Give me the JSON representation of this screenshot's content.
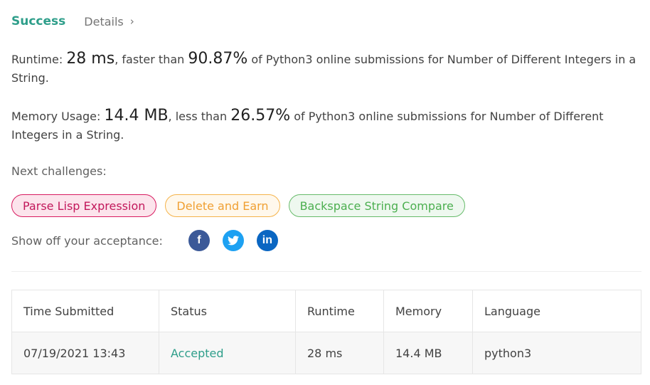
{
  "header": {
    "status": "Success",
    "details_label": "Details",
    "details_chevron": "›"
  },
  "runtime": {
    "label": "Runtime: ",
    "value": "28 ms",
    "comparator": ", faster than ",
    "percent": "90.87%",
    "suffix": " of Python3 online submissions for Number of Different Integers in a String."
  },
  "memory": {
    "label": "Memory Usage: ",
    "value": "14.4 MB",
    "comparator": ", less than ",
    "percent": "26.57%",
    "suffix": " of Python3 online submissions for Number of Different Integers in a String."
  },
  "next_challenges": {
    "label": "Next challenges:",
    "items": [
      {
        "label": "Parse Lisp Expression",
        "difficulty": "hard",
        "color": "#c2185b"
      },
      {
        "label": "Delete and Earn",
        "difficulty": "medium",
        "color": "#f0a033"
      },
      {
        "label": "Backspace String Compare",
        "difficulty": "easy",
        "color": "#4caf50"
      }
    ]
  },
  "share": {
    "label": "Show off your acceptance:",
    "icons": [
      {
        "name": "facebook-icon",
        "glyph": "f",
        "color": "#3b5998"
      },
      {
        "name": "twitter-icon",
        "glyph": "t",
        "color": "#1da1f2"
      },
      {
        "name": "linkedin-icon",
        "glyph": "in",
        "color": "#0a66c2"
      }
    ]
  },
  "submissions": {
    "columns": [
      "Time Submitted",
      "Status",
      "Runtime",
      "Memory",
      "Language"
    ],
    "rows": [
      {
        "time": "07/19/2021 13:43",
        "status": "Accepted",
        "runtime": "28 ms",
        "memory": "14.4 MB",
        "language": "python3"
      }
    ]
  },
  "colors": {
    "accent": "#2e9e8a",
    "text": "#424242"
  }
}
